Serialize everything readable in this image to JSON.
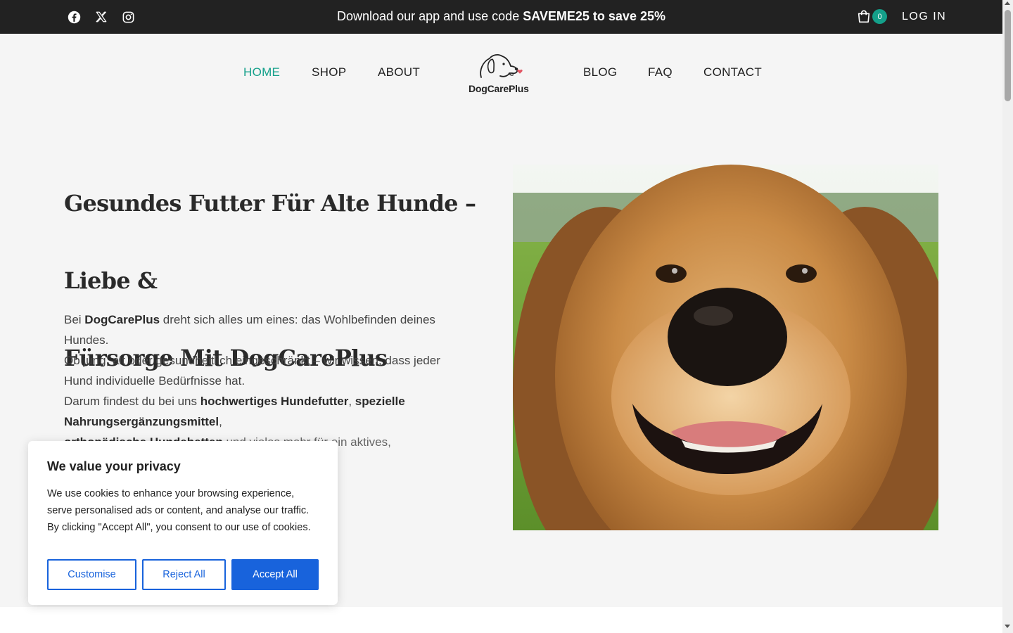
{
  "topbar": {
    "social_icons": [
      "facebook-icon",
      "x-icon",
      "instagram-icon"
    ],
    "promo_prefix": "Download our app and use code ",
    "promo_bold": "SAVEME25 to save 25%",
    "cart_count": "0",
    "login_label": "LOG IN"
  },
  "nav": {
    "home": "HOME",
    "shop": "SHOP",
    "about": "ABOUT",
    "blog": "BLOG",
    "faq": "FAQ",
    "contact": "CONTACT",
    "logo_text": "DogCarePlus"
  },
  "hero": {
    "title_line1": "Gesundes Futter Für Alte Hunde – Liebe &",
    "title_line2": "Fürsorge Mit DogCarePlus",
    "p1_a": "Bei ",
    "p1_b": "DogCarePlus",
    "p1_c": " dreht sich alles um eines: das Wohlbefinden deines Hundes.",
    "p2": "Ob jung, alt oder gesundheitlich eingeschränkt – wir wissen, dass jeder Hund individuelle Bedürfnisse hat.",
    "p3_a": "Darum findest du bei uns ",
    "p3_b": "hochwertiges Hundefutter",
    "p3_c": ", ",
    "p3_d": "spezielle Nahrungsergänzungsmittel",
    "p3_e": ",",
    "p4_a": "orthopädische Hundebetten",
    "p4_b": " und vieles mehr für ein aktives,"
  },
  "cookie": {
    "title": "We value your privacy",
    "text": "We use cookies to enhance your browsing experience, serve personalised ads or content, and analyse our traffic. By clicking \"Accept All\", you consent to our use of cookies.",
    "customise": "Customise",
    "reject": "Reject All",
    "accept": "Accept All"
  },
  "colors": {
    "accent": "#14a08a",
    "topbar": "#222222",
    "button_blue": "#1863dc"
  }
}
